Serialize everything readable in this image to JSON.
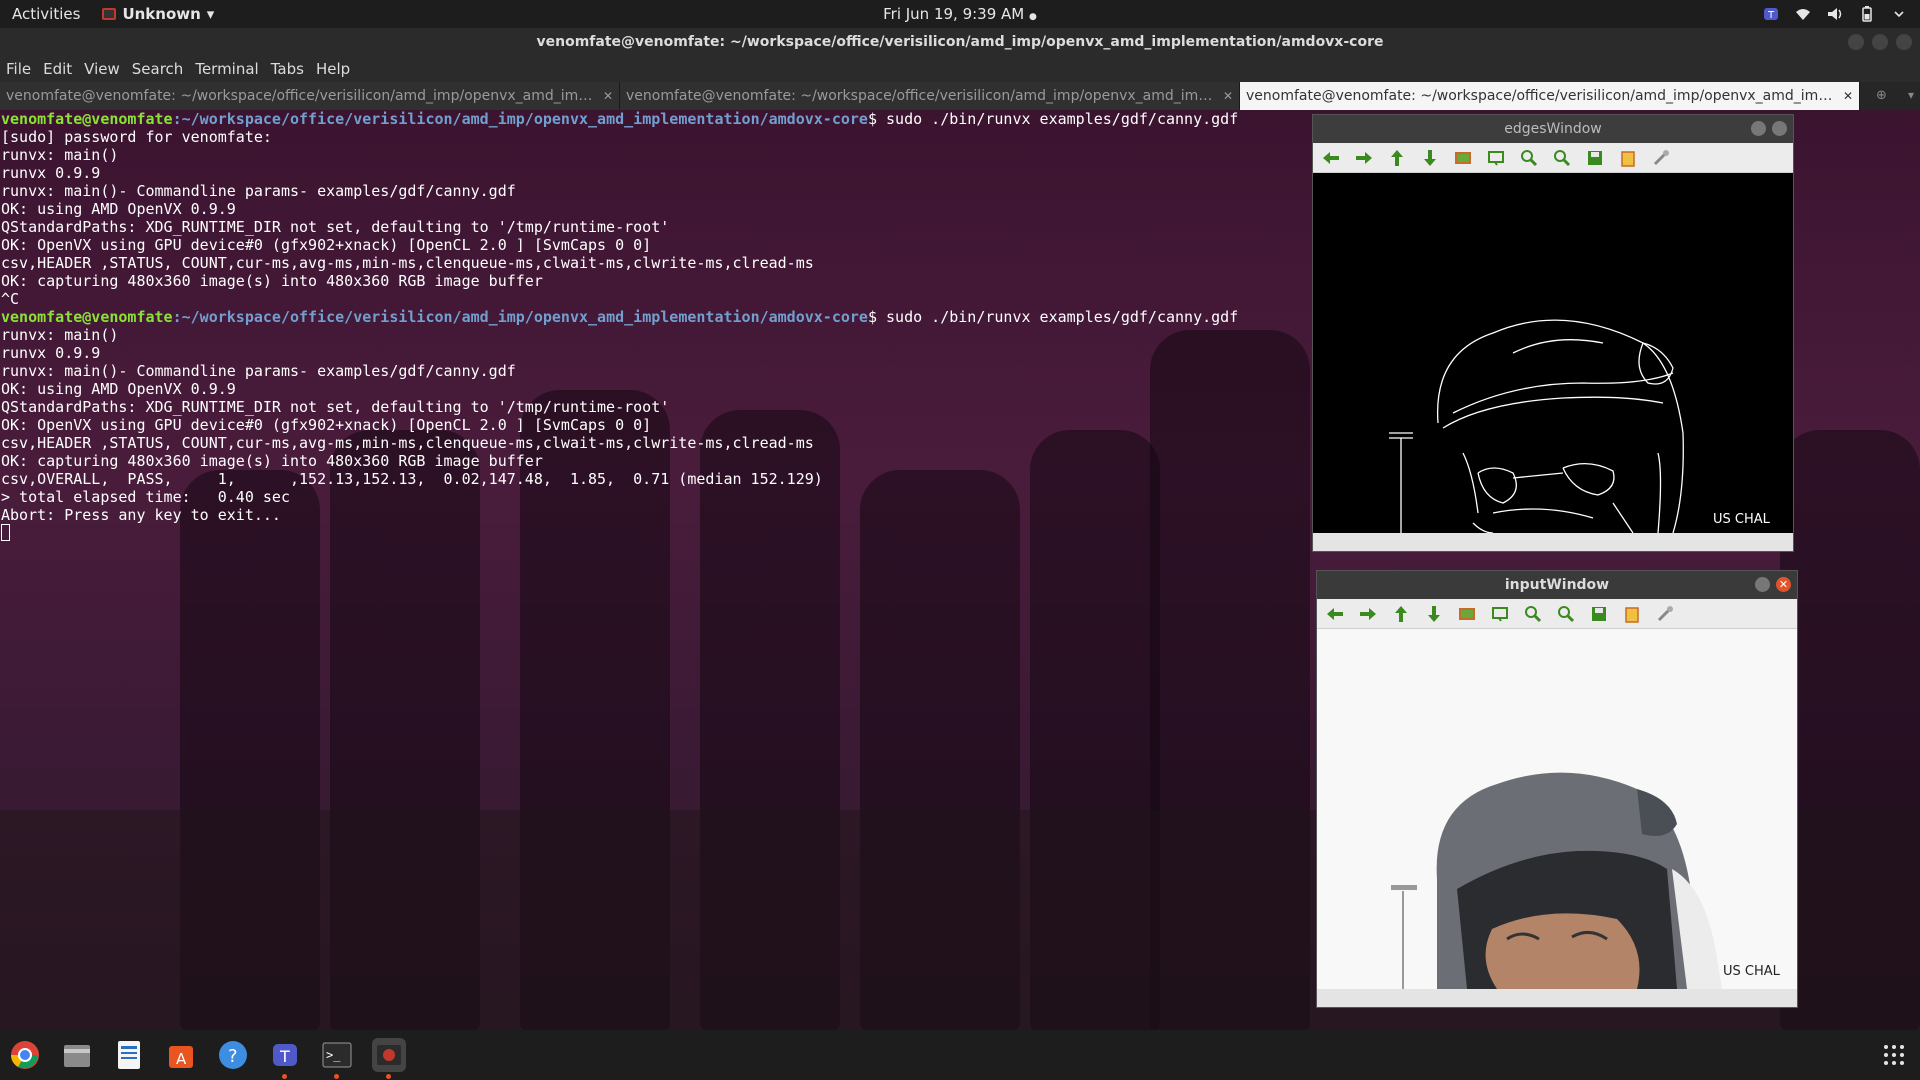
{
  "topbar": {
    "activities": "Activities",
    "app_name": "Unknown",
    "clock": "Fri Jun 19,  9:39 AM",
    "icons": [
      "teams-icon",
      "wifi-icon",
      "volume-icon",
      "battery-icon",
      "power-menu-icon"
    ]
  },
  "terminal": {
    "title": "venomfate@venomfate: ~/workspace/office/verisilicon/amd_imp/openvx_amd_implementation/amdovx-core",
    "menu": [
      "File",
      "Edit",
      "View",
      "Search",
      "Terminal",
      "Tabs",
      "Help"
    ],
    "tabs": [
      {
        "label": "venomfate@venomfate: ~/workspace/office/verisilicon/amd_imp/openvx_amd_imp..."
      },
      {
        "label": "venomfate@venomfate: ~/workspace/office/verisilicon/amd_imp/openvx_amd_imp..."
      },
      {
        "label": "venomfate@venomfate: ~/workspace/office/verisilicon/amd_imp/openvx_amd_imp..."
      }
    ],
    "prompt_user": "venomfate@venomfate",
    "prompt_path": ":~/workspace/office/verisilicon/amd_imp/openvx_amd_implementation/amdovx-core",
    "command": "$ sudo ./bin/runvx examples/gdf/canny.gdf",
    "block1": [
      "[sudo] password for venomfate:",
      "runvx: main()",
      "runvx 0.9.9",
      "runvx: main()- Commandline params- examples/gdf/canny.gdf",
      "OK: using AMD OpenVX 0.9.9",
      "QStandardPaths: XDG_RUNTIME_DIR not set, defaulting to '/tmp/runtime-root'",
      "OK: OpenVX using GPU device#0 (gfx902+xnack) [OpenCL 2.0 ] [SvmCaps 0 0]",
      "csv,HEADER ,STATUS, COUNT,cur-ms,avg-ms,min-ms,clenqueue-ms,clwait-ms,clwrite-ms,clread-ms",
      "OK: capturing 480x360 image(s) into 480x360 RGB image buffer",
      "^C"
    ],
    "block2": [
      "runvx: main()",
      "runvx 0.9.9",
      "runvx: main()- Commandline params- examples/gdf/canny.gdf",
      "OK: using AMD OpenVX 0.9.9",
      "QStandardPaths: XDG_RUNTIME_DIR not set, defaulting to '/tmp/runtime-root'",
      "OK: OpenVX using GPU device#0 (gfx902+xnack) [OpenCL 2.0 ] [SvmCaps 0 0]",
      "csv,HEADER ,STATUS, COUNT,cur-ms,avg-ms,min-ms,clenqueue-ms,clwait-ms,clwrite-ms,clread-ms",
      "OK: capturing 480x360 image(s) into 480x360 RGB image buffer",
      "csv,OVERALL,  PASS,     1,      ,152.13,152.13,  0.02,147.48,  1.85,  0.71 (median 152.129)",
      "> total elapsed time:   0.40 sec",
      "Abort: Press any key to exit..."
    ]
  },
  "edges_window": {
    "title": "edgesWindow",
    "overlay_text": "US CHAL"
  },
  "input_window": {
    "title": "inputWindow",
    "overlay_text": "US CHAL"
  },
  "toolbar_icons": [
    "arrow-left-icon",
    "arrow-right-icon",
    "arrow-up-icon",
    "arrow-down-icon",
    "image-icon",
    "zoom-fit-icon",
    "zoom-in-icon",
    "zoom-out-icon",
    "save-icon",
    "copy-icon",
    "properties-icon"
  ],
  "dock": {
    "apps": [
      "chrome-icon",
      "files-icon",
      "document-viewer-icon",
      "software-center-icon",
      "help-icon",
      "teams-icon",
      "terminal-icon",
      "screen-recorder-icon"
    ]
  }
}
